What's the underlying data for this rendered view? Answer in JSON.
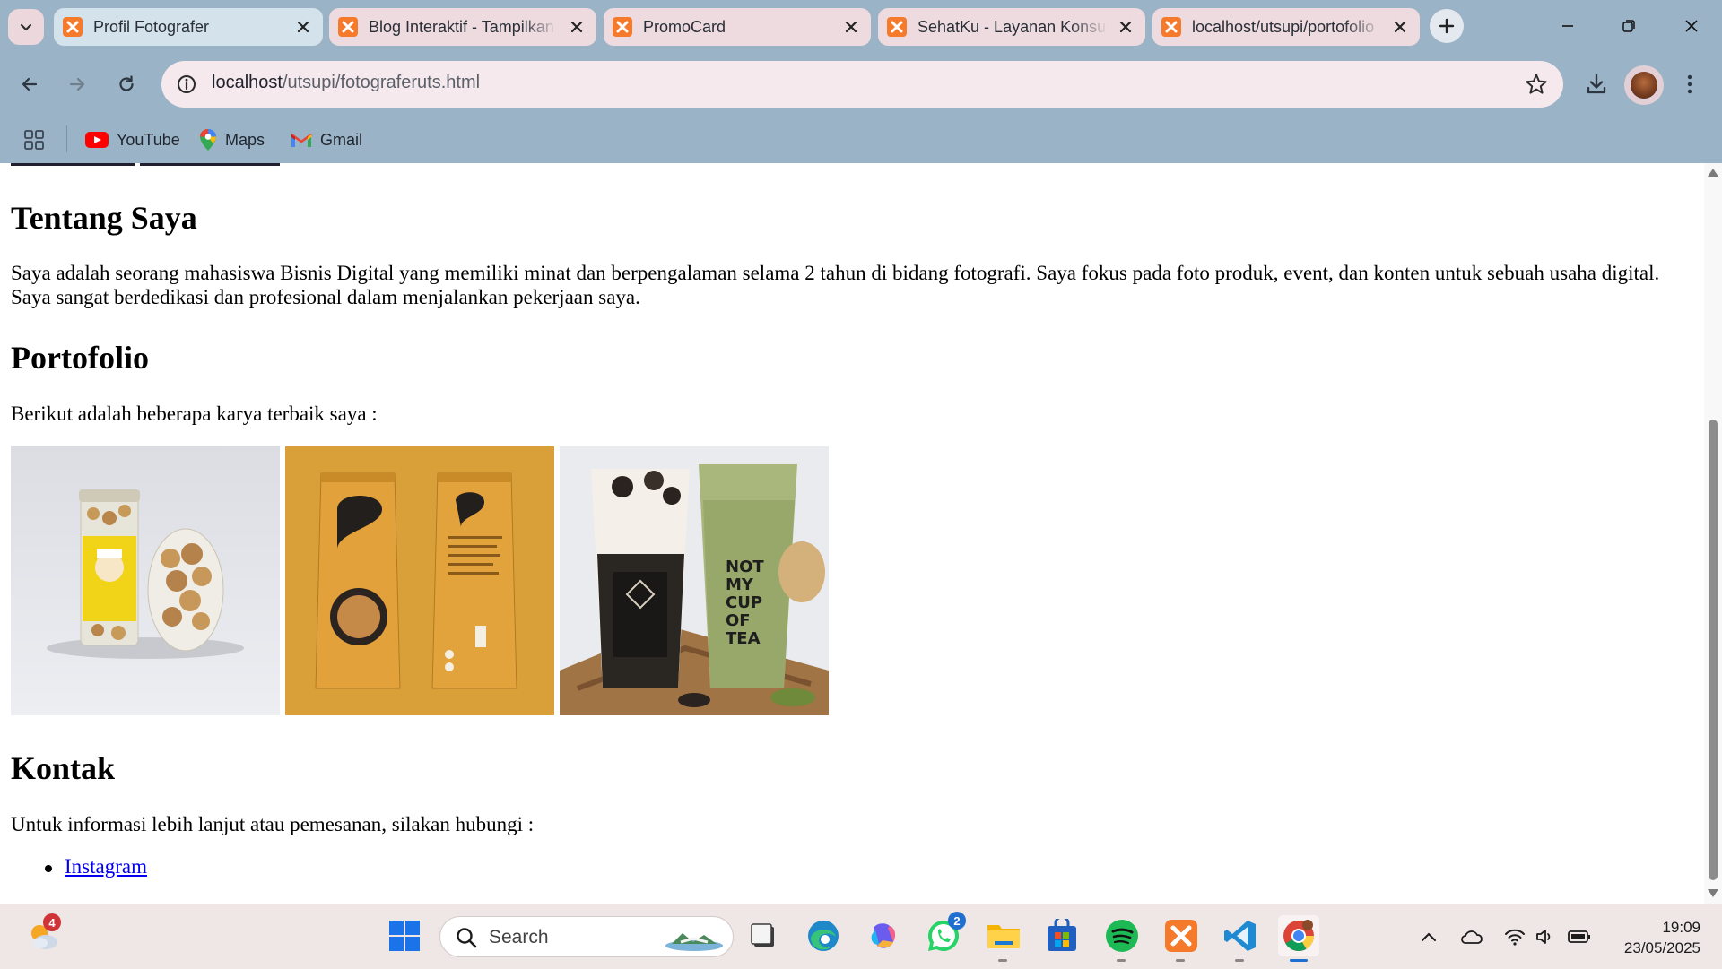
{
  "browser": {
    "tabs": [
      {
        "title": "Profil Fotografer",
        "active": true
      },
      {
        "title": "Blog Interaktif - Tampilkan",
        "active": false
      },
      {
        "title": "PromoCard",
        "active": false
      },
      {
        "title": "SehatKu - Layanan Konsultasi",
        "active": false
      },
      {
        "title": "localhost/utsupi/portofolio",
        "active": false
      }
    ],
    "url_host": "localhost",
    "url_path": "/utsupi/fotograferuts.html",
    "bookmarks": [
      {
        "label": "YouTube",
        "icon": "youtube-icon"
      },
      {
        "label": "Maps",
        "icon": "maps-icon"
      },
      {
        "label": "Gmail",
        "icon": "gmail-icon"
      }
    ]
  },
  "page": {
    "about_heading": "Tentang Saya",
    "about_text": "Saya adalah seorang mahasiswa Bisnis Digital yang memiliki minat dan berpengalaman selama 2 tahun di bidang fotografi. Saya fokus pada foto produk, event, dan konten untuk sebuah usaha digital. Saya sangat berdedikasi dan profesional dalam menjalankan pekerjaan saya.",
    "portfolio_heading": "Portofolio",
    "portfolio_intro": "Berikut adalah beberapa karya terbaik saya :",
    "photos": [
      {
        "name": "photo-snack-jar",
        "caption": ""
      },
      {
        "name": "photo-chips-pouch",
        "caption": ""
      },
      {
        "name": "photo-drinks",
        "caption": ""
      }
    ],
    "contact_heading": "Kontak",
    "contact_intro": "Untuk informasi lebih lanjut atau pemesanan, silakan hubungi :",
    "contact_links": [
      "Instagram"
    ]
  },
  "taskbar": {
    "search_label": "Search",
    "weather_badge": "4",
    "whatsapp_badge": "2",
    "time": "19:09",
    "date": "23/05/2025"
  },
  "colors": {
    "chrome": "#9bb3c6",
    "tab_inactive": "#eddbe0",
    "tab_active": "#d4e2ec",
    "omnibox": "#f6e9ee",
    "link": "#0000ee",
    "taskbar": "#efe7e5"
  }
}
